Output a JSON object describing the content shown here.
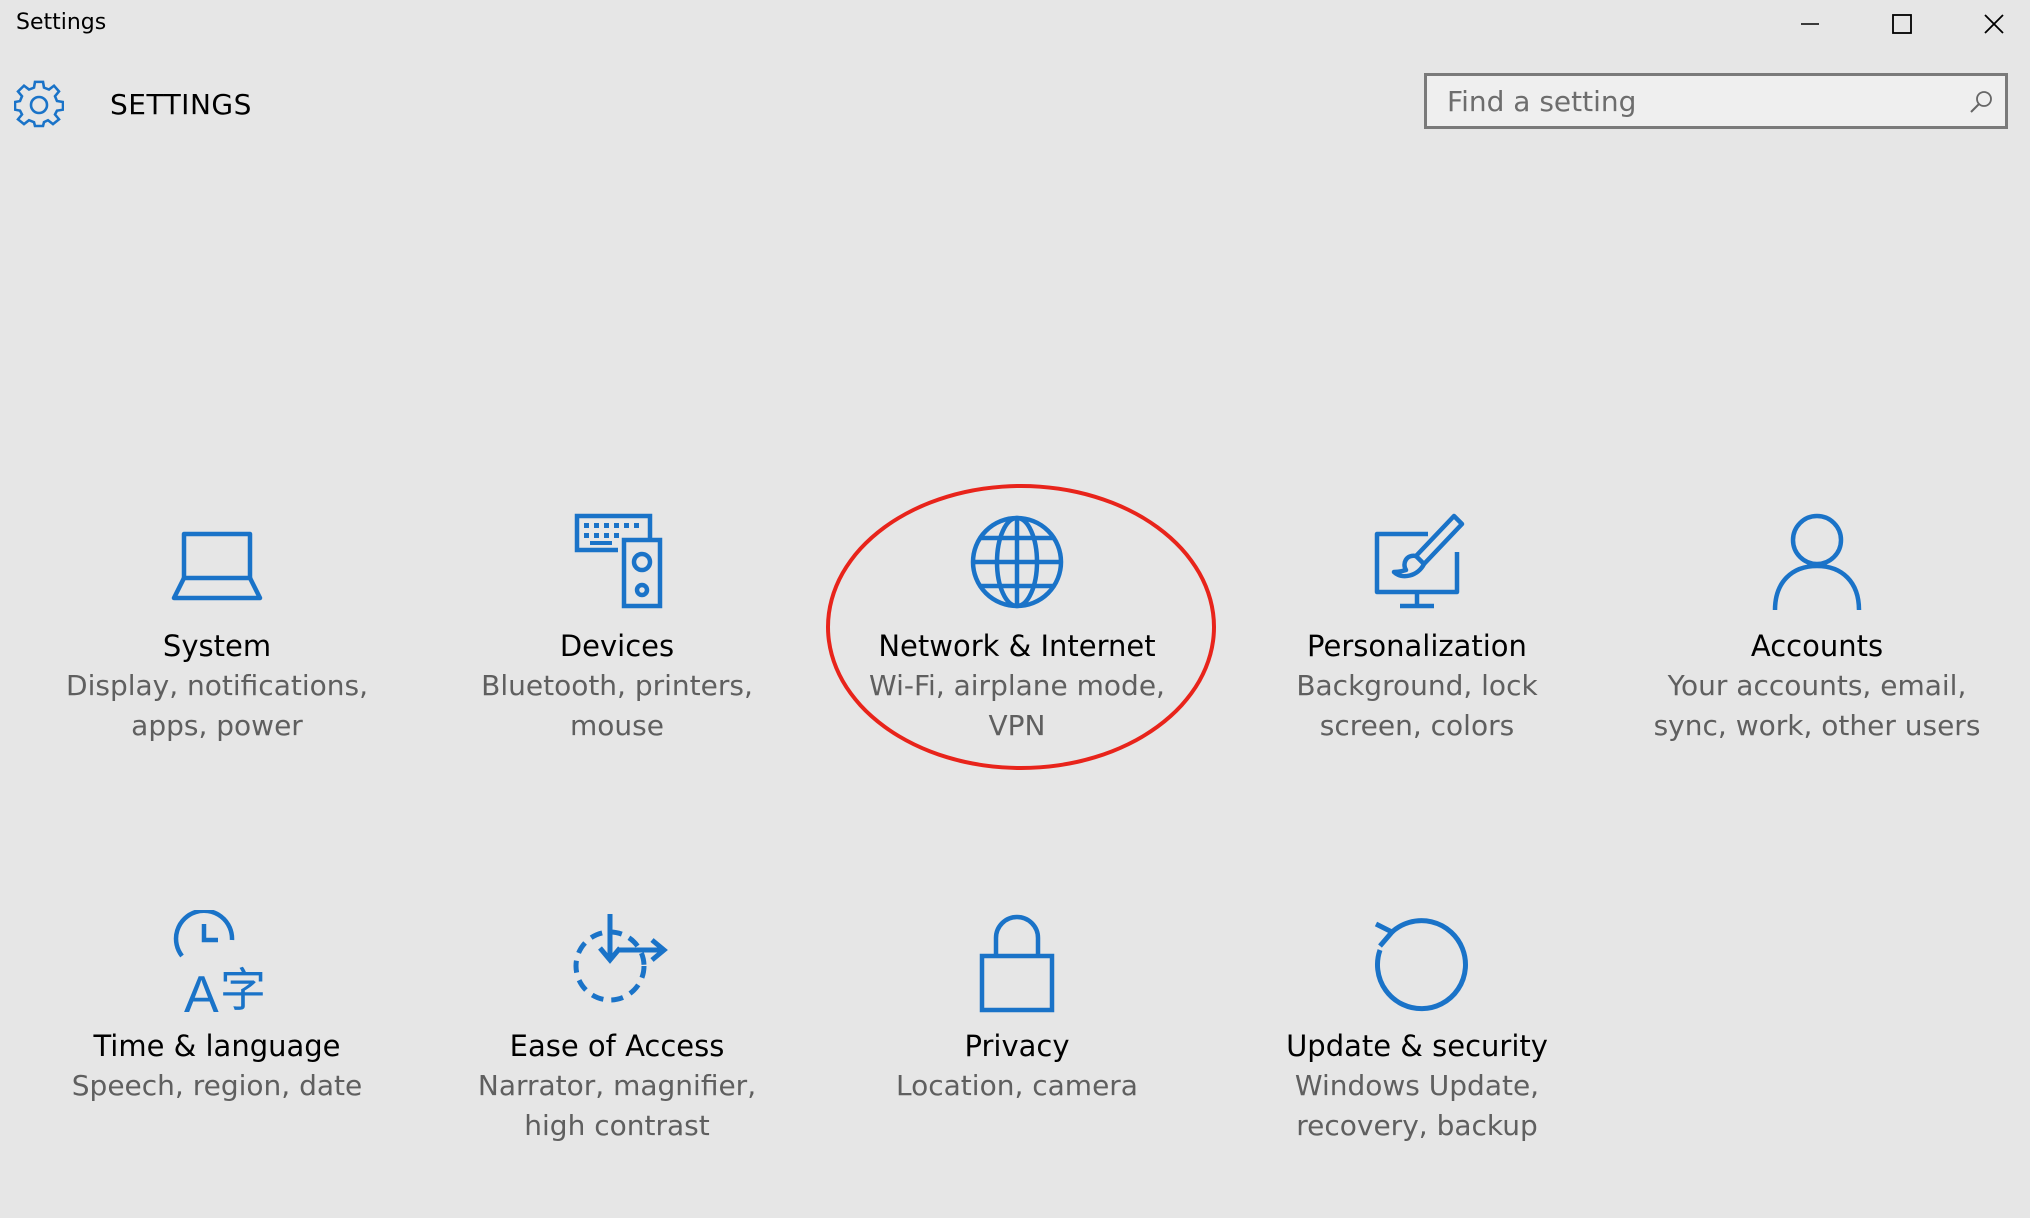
{
  "window": {
    "title": "Settings",
    "controls": [
      "minimize",
      "maximize",
      "close"
    ]
  },
  "header": {
    "title": "SETTINGS",
    "icon": "gear-icon"
  },
  "search": {
    "placeholder": "Find a setting",
    "value": ""
  },
  "colors": {
    "accent": "#1a73c8",
    "background": "#e6e6e6",
    "annotation": "#e8241b"
  },
  "categories": [
    {
      "title": "System",
      "description": "Display, notifications, apps, power",
      "icon": "laptop-icon"
    },
    {
      "title": "Devices",
      "description": "Bluetooth, printers, mouse",
      "icon": "keyboard-speaker-icon"
    },
    {
      "title": "Network & Internet",
      "description": "Wi-Fi, airplane mode, VPN",
      "icon": "globe-icon",
      "highlighted": true
    },
    {
      "title": "Personalization",
      "description": "Background, lock screen, colors",
      "icon": "paintbrush-monitor-icon"
    },
    {
      "title": "Accounts",
      "description": "Your accounts, email, sync, work, other users",
      "icon": "person-icon"
    },
    {
      "title": "Time & language",
      "description": "Speech, region, date",
      "icon": "clock-language-icon"
    },
    {
      "title": "Ease of Access",
      "description": "Narrator, magnifier, high contrast",
      "icon": "ease-of-access-icon"
    },
    {
      "title": "Privacy",
      "description": "Location, camera",
      "icon": "lock-icon"
    },
    {
      "title": "Update & security",
      "description": "Windows Update, recovery, backup",
      "icon": "refresh-icon"
    }
  ]
}
